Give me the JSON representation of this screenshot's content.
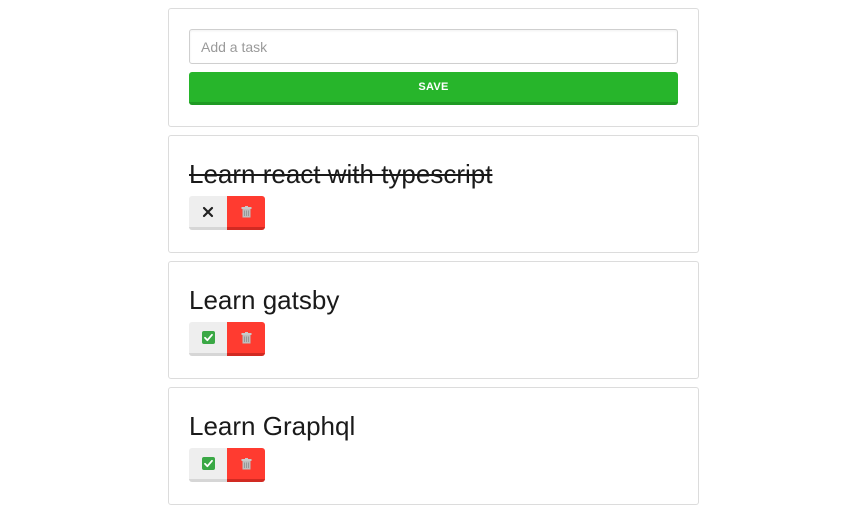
{
  "form": {
    "placeholder": "Add a task",
    "save_label": "SAVE",
    "save_color": "#27b52b"
  },
  "tasks": [
    {
      "title": "Learn react with typescript",
      "done": true,
      "toggle_icon": "close-icon"
    },
    {
      "title": "Learn gatsby",
      "done": false,
      "toggle_icon": "check-box-icon"
    },
    {
      "title": "Learn Graphql",
      "done": false,
      "toggle_icon": "check-box-icon"
    }
  ],
  "colors": {
    "delete": "#ff3b30",
    "check": "#3aa845"
  }
}
